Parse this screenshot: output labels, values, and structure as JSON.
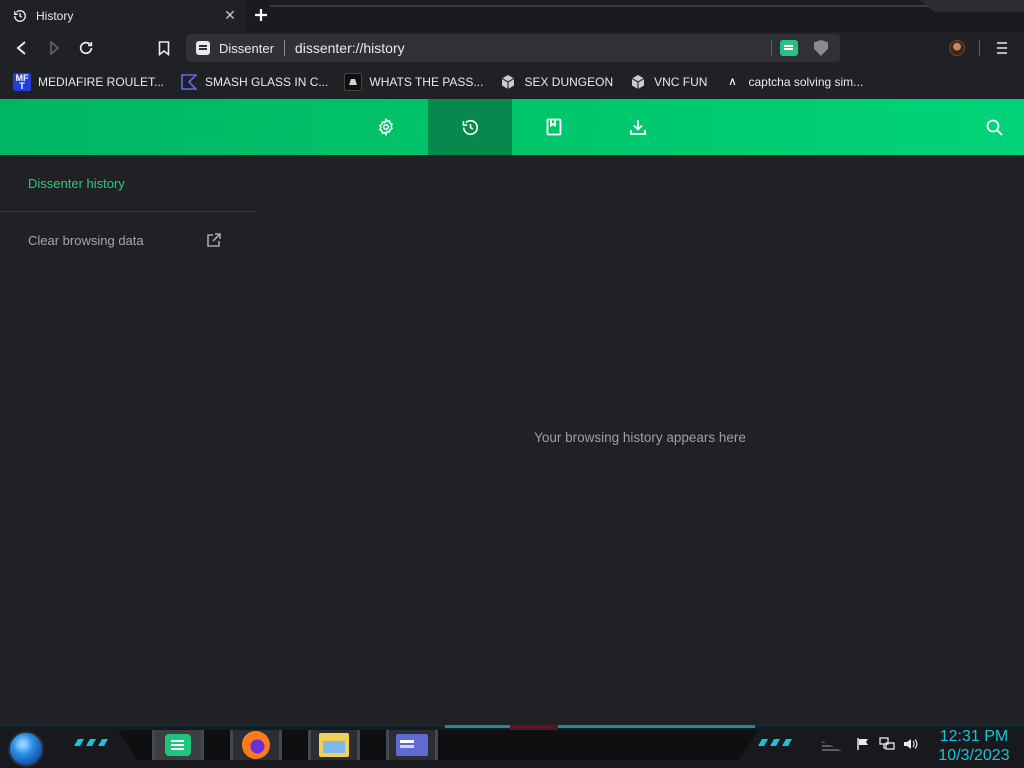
{
  "tab": {
    "title": "History",
    "icon": "history-icon",
    "close_icon": "close-icon"
  },
  "toolbar": {
    "site_name": "Dissenter",
    "url": "dissenter://history"
  },
  "bookmarks": [
    {
      "label": "MEDIAFIRE ROULET...",
      "icon": "mediafire-icon",
      "icon_text": "MF T"
    },
    {
      "label": "SMASH GLASS IN C...",
      "icon": "smash-glass-icon"
    },
    {
      "label": "WHATS THE PASS...",
      "icon": "whats-the-pass-icon"
    },
    {
      "label": "SEX DUNGEON",
      "icon": "cube-icon"
    },
    {
      "label": "VNC FUN",
      "icon": "cube-icon"
    },
    {
      "label": "captcha solving sim...",
      "icon": "captcha-icon",
      "icon_text": "Λ"
    }
  ],
  "history_header": {
    "tabs": [
      "settings",
      "history",
      "bookmarks",
      "downloads"
    ],
    "active_tab": "history"
  },
  "sidebar": {
    "active_item": "Dissenter history",
    "clear_item": "Clear browsing data"
  },
  "main": {
    "empty_message": "Your browsing history appears here"
  },
  "taskbar": {
    "time": "12:31 PM",
    "date": "10/3/2023",
    "apps": [
      "dissenter-app-icon",
      "firefox-icon",
      "file-explorer-icon",
      "card-app-icon"
    ]
  },
  "colors": {
    "accent_green": "#00c46b",
    "active_tab_green": "#07894e",
    "sidebar_active_text": "#2ec97e",
    "clock_cyan": "#19c3d8",
    "background": "#202124"
  }
}
